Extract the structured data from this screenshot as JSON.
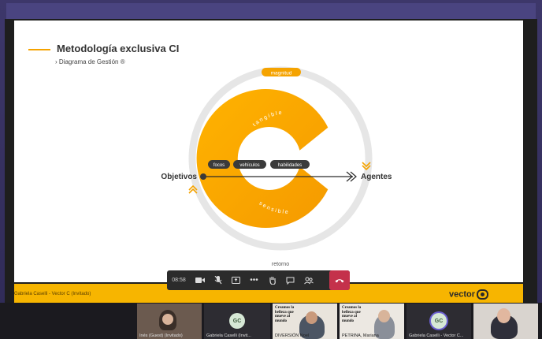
{
  "slide": {
    "title": "Metodología exclusiva CI",
    "subtitle": "› Diagrama de Gestión ®"
  },
  "diagram": {
    "tag_top": "magnitud",
    "arc_top": "tangible",
    "arc_bottom": "sensible",
    "left": "Objetivos",
    "right": "Agentes",
    "bottom": "retorno",
    "pills": [
      "focos",
      "vehículos",
      "habilidades"
    ]
  },
  "strip": {
    "presenter": "Gabriela Caselli - Vector C (Invitado)",
    "logo": "vector"
  },
  "controls": {
    "time": "08:58"
  },
  "participants": [
    {
      "name": "Inés (Guest) (Invitado)"
    },
    {
      "name": "Gabriela Caselli (Invit...",
      "initials": "GC"
    },
    {
      "name": "DIVERSIÓN Noel",
      "poster": "Creamos la belleza que mueve al mundo"
    },
    {
      "name": "PETRINA, Mariana",
      "poster": "Creamos la belleza que mueve al mundo"
    },
    {
      "name": "Gabriela Caselli - Vector C...",
      "initials": "GC"
    },
    {
      "name": ""
    }
  ],
  "colors": {
    "accent": "#f5a300",
    "ring": "#e6e6e6",
    "strip": "#f7b500",
    "hangup": "#c4314b"
  }
}
